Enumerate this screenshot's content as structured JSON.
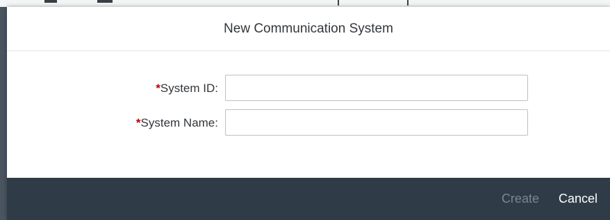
{
  "dialog": {
    "title": "New Communication System"
  },
  "form": {
    "fields": [
      {
        "required_marker": "*",
        "label": "System ID:",
        "value": "",
        "placeholder": ""
      },
      {
        "required_marker": "*",
        "label": "System Name:",
        "value": "",
        "placeholder": ""
      }
    ]
  },
  "footer": {
    "create_label": "Create",
    "cancel_label": "Cancel",
    "create_enabled": false
  },
  "colors": {
    "footer_background": "#2f3c48",
    "required_marker": "#bb0000",
    "disabled_button_text": "#7b8792"
  }
}
